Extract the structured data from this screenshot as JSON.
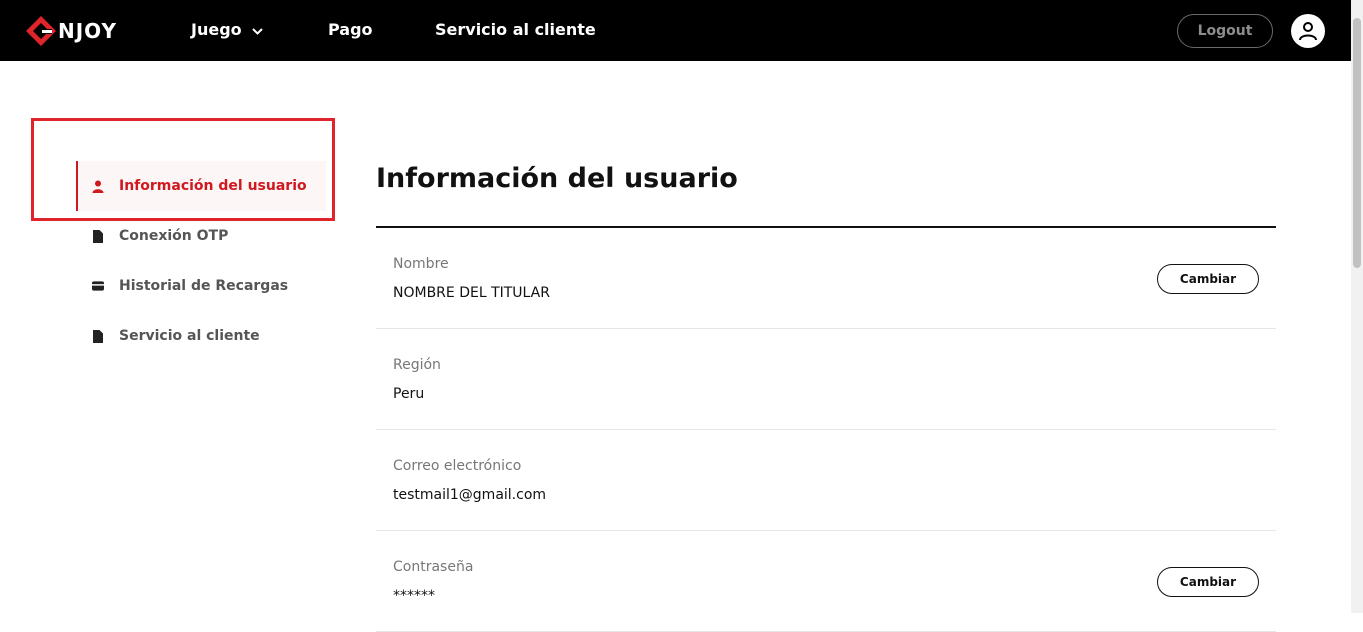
{
  "header": {
    "logo_text": "NJOY",
    "nav": [
      {
        "label": "Juego",
        "has_dropdown": true
      },
      {
        "label": "Pago"
      },
      {
        "label": "Servicio al cliente"
      }
    ],
    "logout_label": "Logout",
    "colors": {
      "bar": "#000000",
      "accent": "#e0242b"
    }
  },
  "sidebar": {
    "items": [
      {
        "label": "Información del usuario",
        "icon": "user-icon",
        "active": true
      },
      {
        "label": "Conexión OTP",
        "icon": "document-icon"
      },
      {
        "label": "Historial de Recargas",
        "icon": "card-icon"
      },
      {
        "label": "Servicio al cliente",
        "icon": "document-icon"
      }
    ]
  },
  "main": {
    "title": "Información del usuario",
    "fields": [
      {
        "label": "Nombre",
        "value": "NOMBRE DEL TITULAR",
        "action": "Cambiar"
      },
      {
        "label": "Región",
        "value": "Peru"
      },
      {
        "label": "Correo electrónico",
        "value": "testmail1@gmail.com"
      },
      {
        "label": "Contraseña",
        "value": "******",
        "action": "Cambiar"
      }
    ]
  }
}
